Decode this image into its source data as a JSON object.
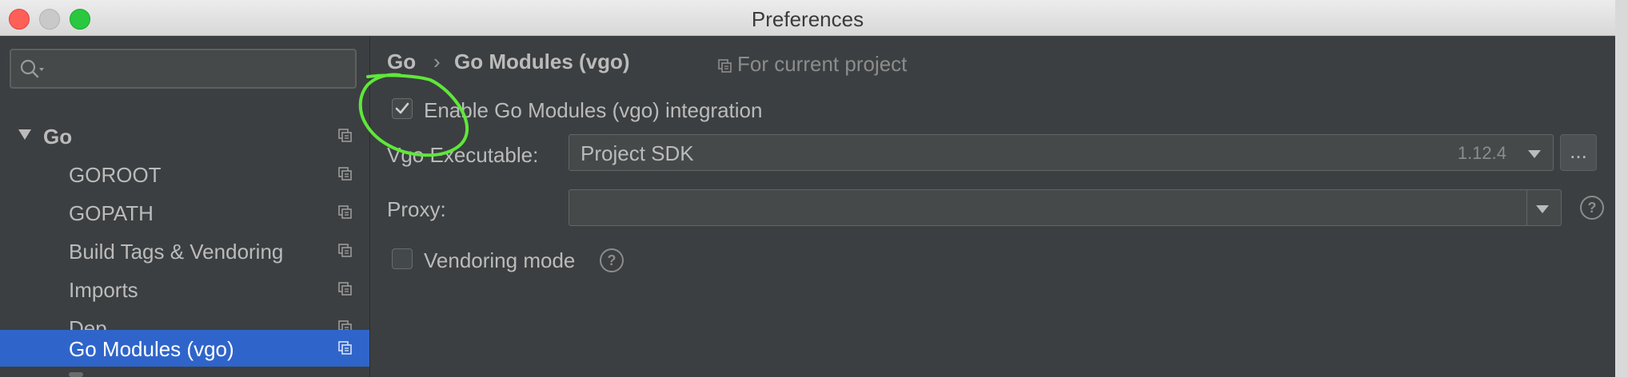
{
  "window": {
    "title": "Preferences"
  },
  "sidebar": {
    "search_placeholder": "",
    "items": [
      {
        "label": "Go",
        "expanded": true
      },
      {
        "label": "GOROOT"
      },
      {
        "label": "GOPATH"
      },
      {
        "label": "Build Tags & Vendoring"
      },
      {
        "label": "Imports"
      },
      {
        "label": "Dep"
      },
      {
        "label": "Go Modules (vgo)",
        "selected": true
      }
    ]
  },
  "breadcrumb": {
    "parent": "Go",
    "separator": "›",
    "current": "Go Modules (vgo)"
  },
  "scope": {
    "label": "For current project"
  },
  "settings": {
    "enable_label": "Enable Go Modules (vgo) integration",
    "enable_checked": true,
    "executable_label": "Vgo Executable:",
    "executable_value": "Project SDK",
    "executable_version": "1.12.4",
    "browse_label": "...",
    "proxy_label": "Proxy:",
    "proxy_value": "",
    "vendoring_label": "Vendoring mode",
    "vendoring_checked": false,
    "help_glyph": "?"
  },
  "colors": {
    "background": "#3c3f41",
    "selection": "#2f65ca",
    "text": "#bbbbbb",
    "annotation": "#5ee83a"
  },
  "icons": [
    "search-icon",
    "copy-icon",
    "expand-arrow-icon",
    "chevron-down-icon",
    "help-icon",
    "checkmark-icon"
  ]
}
